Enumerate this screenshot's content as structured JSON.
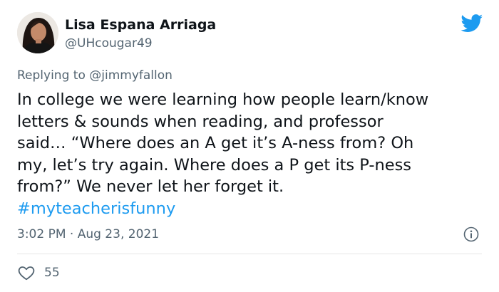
{
  "author": {
    "display_name": "Lisa Espana Arriaga",
    "handle": "@UHcougar49"
  },
  "reply": {
    "prefix": "Replying to ",
    "mention": "@jimmyfallon"
  },
  "body": {
    "lines": [
      "In college we were learning how people learn/know",
      "letters & sounds when reading, and professor",
      "said… “Where does an A get it’s A-ness from? Oh",
      "my, let’s try again. Where does a P get its P-ness",
      "from?” We never let her forget it."
    ],
    "hashtag": "#myteacherisfunny"
  },
  "meta": {
    "timestamp": "3:02 PM · Aug 23, 2021"
  },
  "engagement": {
    "likes": "55"
  },
  "icons": {
    "brand": "twitter-bird-icon",
    "info": "info-icon",
    "like": "heart-icon"
  },
  "colors": {
    "brand": "#1d9bf0",
    "text": "#0f1419",
    "secondary": "#536471",
    "divider": "#e7e7e7"
  }
}
